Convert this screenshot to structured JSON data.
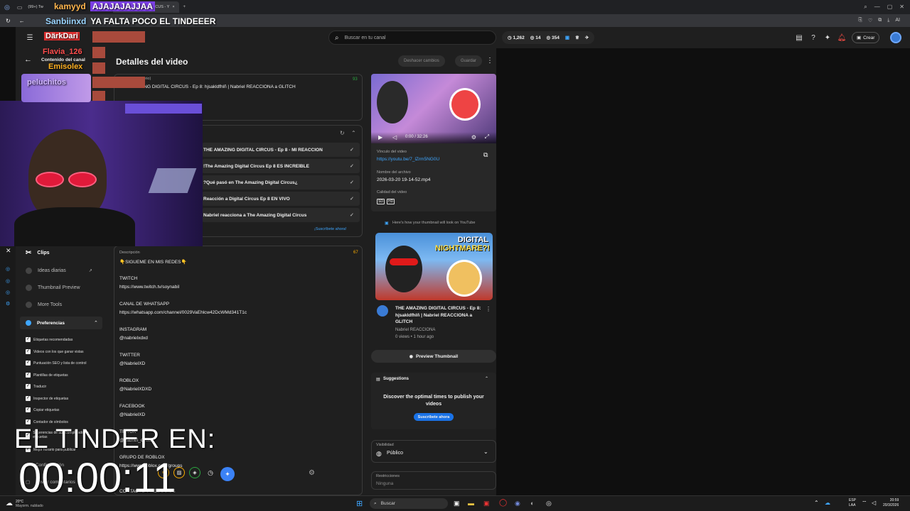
{
  "browser": {
    "tabs": [
      "(99+) Tw",
      "kamyyd",
      "(130) DIGITAL CIRCUS - Y"
    ],
    "url": ""
  },
  "overlay": {
    "chat_user1": "kamyyd",
    "chat_msg1": "AJAJAJAJJAA",
    "chat_user2": "Sanbiinxd",
    "chat_msg2": "YA FALTA POCO EL TINDEEER",
    "name_dari": "DärkDari",
    "name_flavia": "Flavia_126",
    "name_emisolex": "Emisolex",
    "name_peluche": "peluchitos",
    "timer_label": "EL TINDER EN:",
    "timer_value": "00:00:11"
  },
  "header": {
    "search_placeholder": "Buscar en tu canal",
    "stat1": "1,262",
    "stat2": "14",
    "stat3": "354",
    "create_label": "Crear"
  },
  "nav": {
    "channel_content": "Contenido del canal"
  },
  "page": {
    "title": "Detalles del video",
    "undo_label": "Deshacer cambios",
    "save_label": "Guardar",
    "title_field_label": "Título (obligatorio)",
    "title_value": "THE AMAZING DIGITAL CIRCUS - Ep 8: hjsakldfhlñ | Nabriel REACCIONA a GLITCH",
    "title_count": "93",
    "subscribe_now": "¡Suscríbete ahora!"
  },
  "suggestions_list": [
    "THE AMAZING DIGITAL CIRCUS - Ep 8 - MI REACCIÓN",
    "The Amazing Digital Circus Ep 8 ES INCREÍBLE!",
    "¿Qué pasó en The Amazing Digital Circus?",
    "Reacción a Digital Circus Ep 8 EN VIVO",
    "Nabriel reacciona a The Amazing Digital Circus"
  ],
  "description": {
    "label": "Descripción",
    "count": "67",
    "lines": [
      "👇SIGUEME EN MIS REDES👇",
      "TWITCH",
      "https://www.twitch.tv/soynabil",
      "CANAL DE WHATSAPP",
      "https://whatsapp.com/channel/0029VaEhlcw42DcWMd341T1c",
      "INSTAGRAM",
      "@nabrielxdxd",
      "TWITTER",
      "@NabrielXD",
      "ROBLOX",
      "@NabrielXDXD",
      "FACEBOOK",
      "@NabrielXD",
      "TIKTOK",
      "@nabriel_oficial",
      "GRUPO DE ROBLOX",
      "https://www.roblox.com/groups",
      "CONTACTO Y NEGOCIOS"
    ]
  },
  "video_panel": {
    "time": "0:00 / 32:26",
    "link_label": "Vínculo del video",
    "link": "https://youtu.be/7_lZrm5NG0U",
    "filename_label": "Nombre del archivo",
    "filename": "2026-03-20 19-14-52.mp4",
    "quality_label": "Calidad del video",
    "quality_sd": "SD",
    "quality_hd": "HD"
  },
  "thumb_preview": {
    "note": "Here's how your thumbnail will look on YouTube",
    "thumb_text1": "DIGITAL",
    "thumb_text2": "NIGHTMARE?!",
    "video_title": "THE AMAZING DIGITAL CIRCUS - Ep 8: hjsakldfhlñ | Nabriel REACCIONA a GLITCH",
    "channel": "Nabriel REACCIONA",
    "meta": "0 views • 1 hour ago",
    "preview_btn": "Preview Thumbnail"
  },
  "suggestions_panel": {
    "title": "Suggestions",
    "text": "Discover the optimal times to publish your videos",
    "btn": "Suscríbete ahora"
  },
  "visibility": {
    "label": "Visibilidad",
    "value": "Público"
  },
  "restrictions": {
    "label": "Restricciones",
    "value": "Ninguna"
  },
  "sidepanel": {
    "clips": "Clips",
    "items": [
      "Ideas diarias",
      "Thumbnail Preview",
      "More Tools"
    ],
    "prefs_title": "Preferencias",
    "prefs": [
      "Etiquetas recomendadas",
      "Videos con los que ganar vistas",
      "Puntuación SEO y lista de control",
      "Plantillas de etiquetas",
      "Traducir",
      "Inspector de etiquetas",
      "Copiar etiquetas",
      "Contador de símbolos",
      "Sugerencias de autocompletado de etiquetas",
      "Mejor horario para publicar"
    ],
    "config": "Configuración",
    "feedback": "Enviar comentarios"
  },
  "taskbar": {
    "weather_temp": "20°C",
    "weather_desc": "Mayorm. nublado",
    "search": "Buscar",
    "lang1": "ESP",
    "lang2": "LAA",
    "time": "20:59",
    "date": "20/3/2026"
  },
  "colors": {
    "accent_blue": "#3ea6ff",
    "subscribe_blue": "#1a73e8",
    "green_count": "#2ba640",
    "yellow_count": "#f9ab00"
  }
}
